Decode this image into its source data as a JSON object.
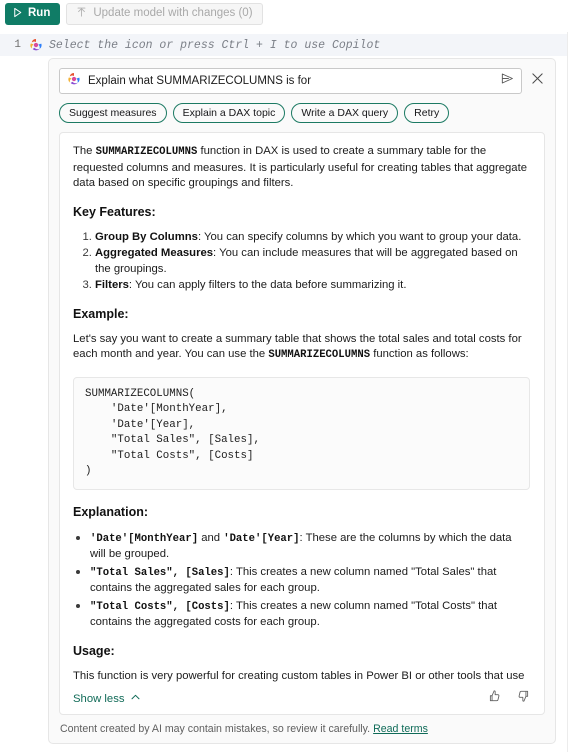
{
  "toolbar": {
    "run_label": "Run",
    "run_icon": "play-triangle-icon",
    "run_color": "#107c66",
    "update_label": "Update model with changes (0)",
    "update_icon": "upload-arrow-icon"
  },
  "editor": {
    "line_number": "1",
    "copilot_icon": "copilot-icon",
    "hint_text": "Select the icon or press Ctrl + I to use Copilot"
  },
  "copilot": {
    "prompt": {
      "icon": "copilot-icon",
      "value": "Explain what SUMMARIZECOLUMNS is for",
      "placeholder": "Explain what SUMMARIZECOLUMNS is for",
      "send_icon": "send-arrow-icon",
      "close_icon": "close-x-icon"
    },
    "chips": [
      {
        "label": "Suggest measures"
      },
      {
        "label": "Explain a DAX topic"
      },
      {
        "label": "Write a DAX query"
      },
      {
        "label": "Retry"
      }
    ],
    "chip_border_color": "#1c7a63",
    "answer": {
      "intro": {
        "before": "The ",
        "code": "SUMMARIZECOLUMNS",
        "after": " function in DAX is used to create a summary table for the requested columns and measures. It is particularly useful for creating tables that aggregate data based on specific groupings and filters."
      },
      "key_features_heading": "Key Features:",
      "key_features": [
        {
          "term": "Group By Columns",
          "desc": ": You can specify columns by which you want to group your data."
        },
        {
          "term": "Aggregated Measures",
          "desc": ": You can include measures that will be aggregated based on the groupings."
        },
        {
          "term": "Filters",
          "desc": ": You can apply filters to the data before summarizing it."
        }
      ],
      "example_heading": "Example:",
      "example_intro": {
        "before": "Let's say you want to create a summary table that shows the total sales and total costs for each month and year. You can use the ",
        "code": "SUMMARIZECOLUMNS",
        "after": " function as follows:"
      },
      "code_block": "SUMMARIZECOLUMNS(\n    'Date'[MonthYear],\n    'Date'[Year],\n    \"Total Sales\", [Sales],\n    \"Total Costs\", [Costs]\n)",
      "explanation_heading": "Explanation:",
      "explanation_items": [
        {
          "code1": "'Date'[MonthYear]",
          "mid": " and ",
          "code2": "'Date'[Year]",
          "desc": ": These are the columns by which the data will be grouped."
        },
        {
          "code1": "\"Total Sales\", [Sales]",
          "mid": "",
          "code2": "",
          "desc": ": This creates a new column named \"Total Sales\" that contains the aggregated sales for each group."
        },
        {
          "code1": "\"Total Costs\", [Costs]",
          "mid": "",
          "code2": "",
          "desc": ": This creates a new column named \"Total Costs\" that contains the aggregated costs for each group."
        }
      ],
      "usage_heading": "Usage:",
      "usage_text": "This function is very powerful for creating custom tables in Power BI or other tools that use DAX, allowing you to tailor the data presentation to specific needs and analyses.",
      "show_less_label": "Show less",
      "show_less_icon": "chevron-up-icon",
      "thumbs_up_icon": "thumbs-up-icon",
      "thumbs_down_icon": "thumbs-down-icon",
      "link_color": "#116b58"
    },
    "disclaimer": {
      "text": "Content created by AI may contain mistakes, so review it carefully.",
      "link_label": "Read terms"
    }
  }
}
